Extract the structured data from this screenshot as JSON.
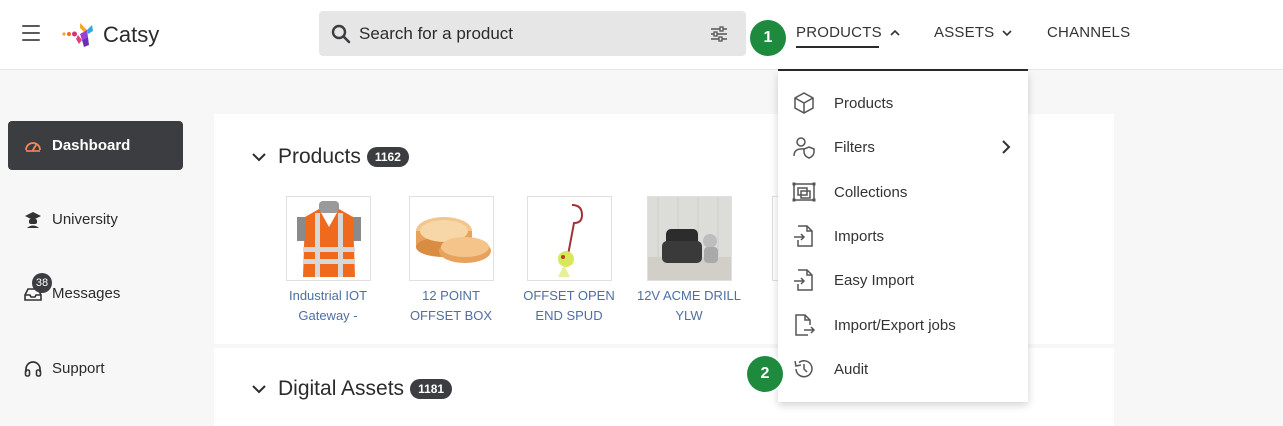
{
  "app": {
    "name": "Catsy"
  },
  "search": {
    "placeholder": "Search for a product"
  },
  "nav": {
    "products": "PRODUCTS",
    "assets": "ASSETS",
    "channels": "CHANNELS"
  },
  "steps": {
    "one": "1",
    "two": "2"
  },
  "sidebar": {
    "items": [
      {
        "label": "Dashboard",
        "icon": "speedometer-icon",
        "active": true
      },
      {
        "label": "University",
        "icon": "graduation-icon"
      },
      {
        "label": "Messages",
        "icon": "inbox-icon",
        "badge": "38"
      },
      {
        "label": "Support",
        "icon": "headset-icon"
      }
    ]
  },
  "products_section": {
    "title": "Products",
    "count": "1162",
    "items": [
      {
        "line1": "Industrial IOT",
        "line2": "Gateway -"
      },
      {
        "line1": "12 POINT",
        "line2": "OFFSET BOX"
      },
      {
        "line1": "OFFSET OPEN",
        "line2": "END SPUD"
      },
      {
        "line1": "12V ACME DRILL",
        "line2": "YLW"
      }
    ]
  },
  "assets_section": {
    "title": "Digital Assets",
    "count": "1181"
  },
  "products_menu": {
    "items": [
      {
        "label": "Products",
        "icon": "cube-icon"
      },
      {
        "label": "Filters",
        "icon": "user-shield-icon",
        "submenu": true
      },
      {
        "label": "Collections",
        "icon": "collection-icon"
      },
      {
        "label": "Imports",
        "icon": "file-import-icon"
      },
      {
        "label": "Easy Import",
        "icon": "file-import-icon"
      },
      {
        "label": "Import/Export jobs",
        "icon": "file-export-icon"
      },
      {
        "label": "Audit",
        "icon": "history-icon"
      }
    ]
  },
  "colors": {
    "accent_green": "#1e8a3e",
    "dark": "#3b3d40",
    "link": "#4d6fa3"
  }
}
